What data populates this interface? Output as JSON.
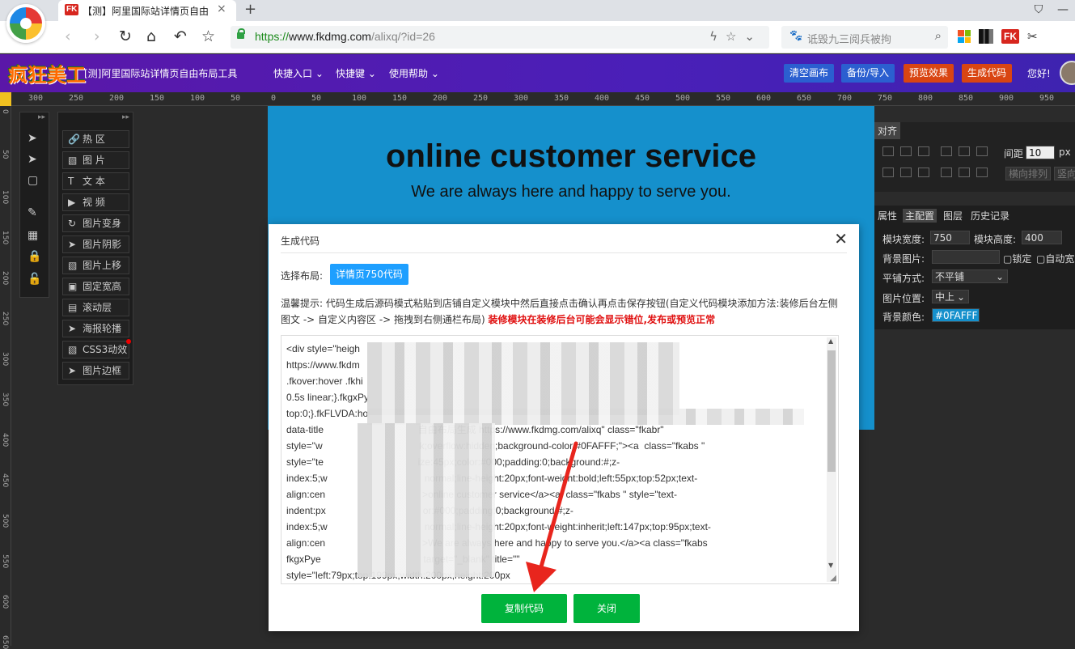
{
  "browser": {
    "tab_fk_badge": "FK",
    "tab_title": "【测】阿里国际站详情页自由",
    "tab_close": "×",
    "new_tab": "+",
    "url_https": "https://",
    "url_host": "www.fkdmg.com",
    "url_path": "/alixq/?id=26",
    "search_placeholder": "诋毁九三阅兵被拘",
    "ext_fk": "FK"
  },
  "app": {
    "logo_text": "疯狂美工",
    "title": "[测]阿里国际站详情页自由布局工具",
    "menus": [
      "快捷入口",
      "快捷键",
      "使用帮助"
    ],
    "buttons": {
      "clear": "清空画布",
      "backup": "备份/导入",
      "preview": "预览效果",
      "generate": "生成代码"
    },
    "greeting": "您好!"
  },
  "ruler_top": [
    "300",
    "250",
    "200",
    "150",
    "100",
    "50",
    "0",
    "50",
    "100",
    "150",
    "200",
    "250",
    "300",
    "350",
    "400",
    "450",
    "500",
    "550",
    "600",
    "650",
    "700",
    "750",
    "800",
    "850",
    "900",
    "950"
  ],
  "ruler_left": [
    "0",
    "50",
    "100",
    "150",
    "200",
    "250",
    "300",
    "350",
    "400",
    "450",
    "500",
    "550",
    "600",
    "650"
  ],
  "tools": [
    "热 区",
    "图 片",
    "文 本",
    "视 频",
    "图片变身",
    "图片阴影",
    "图片上移",
    "固定宽高",
    "滚动层",
    "海报轮播",
    "CSS3动效",
    "图片边框"
  ],
  "canvas": {
    "title": "online customer service",
    "subtitle": "We are always here and happy to serve you.",
    "bg_color": "#0FAFFF"
  },
  "align_panel": {
    "tab": "对齐",
    "spacing_label": "间距",
    "spacing_value": "10",
    "spacing_unit": "px",
    "btn_horizontal": "横向排列",
    "btn_vertical": "竖向"
  },
  "props_panel": {
    "tabs": [
      "属性",
      "主配置",
      "图层",
      "历史记录"
    ],
    "width_label": "模块宽度:",
    "width_value": "750",
    "height_label": "模块高度:",
    "height_value": "400",
    "bgimg_label": "背景图片:",
    "lock_label": "锁定",
    "autowidth_label": "自动宽",
    "tile_label": "平铺方式:",
    "tile_value": "不平铺",
    "pos_label": "图片位置:",
    "pos_value": "中上",
    "bgcolor_label": "背景颜色:",
    "bgcolor_value": "#0FAFFF"
  },
  "modal": {
    "title": "生成代码",
    "close": "✕",
    "layout_label": "选择布局:",
    "layout_button": "详情页750代码",
    "tip_prefix": "温馨提示: 代码生成后源码模式粘贴到店铺自定义模块中然后直接点击确认再点击保存按钮(自定义代码模块添加方法:装修后台左侧图文 -> 自定义内容区 -> 拖拽到右侧通栏布局)",
    "tip_warning": "装修模块在装修后台可能会显示错位,发布或预览正常",
    "code_lines": [
      "<div style=\"heigh",
      "https://www.fkdm",
      ".fkover:hover .fkhi",
      "0.5s linear;}.fkgxPy",
      "top:0;}.fkFLVDA:ho",
      "data-title                                   自由布局生成 https://www.fkdmg.com/alixq\" class=\"fkabr\"",
      "style=\"w                                    k;overflow:hidden;background-color:#0FAFFF;\"><a  class=\"fkabs \"",
      "style=\"te                                   ize:45px;color:#000;padding:0;background:#;z-",
      "index:5;w                                    normal;line-height:20px;font-weight:bold;left:55px;top:52px;text-",
      "align:cen                                    >online customer service</a><a  class=\"fkabs \" style=\"text-",
      "indent:px                                    or:#000;padding:0;background:#;z-",
      "index:5;w                                    normal;line-height:20px;font-weight:inherit;left:147px;top:95px;text-",
      "align:cen                                    >We are always here and happy to serve you.</a><a class=\"fkabs",
      "fkgxPye                                      target=\"_blank\" title=\"\"",
      "style=\"left:79px;top:199px;width:200px;height:200px"
    ],
    "copy_button": "复制代码",
    "close_button": "关闭"
  },
  "colors": {
    "header_purple": "#4a1fb8",
    "btn_blue": "#2b5fd0",
    "btn_red": "#d94512",
    "modal_green": "#00b33c",
    "layout_blue": "#1e9fff",
    "annotation_red": "#e8251d"
  }
}
